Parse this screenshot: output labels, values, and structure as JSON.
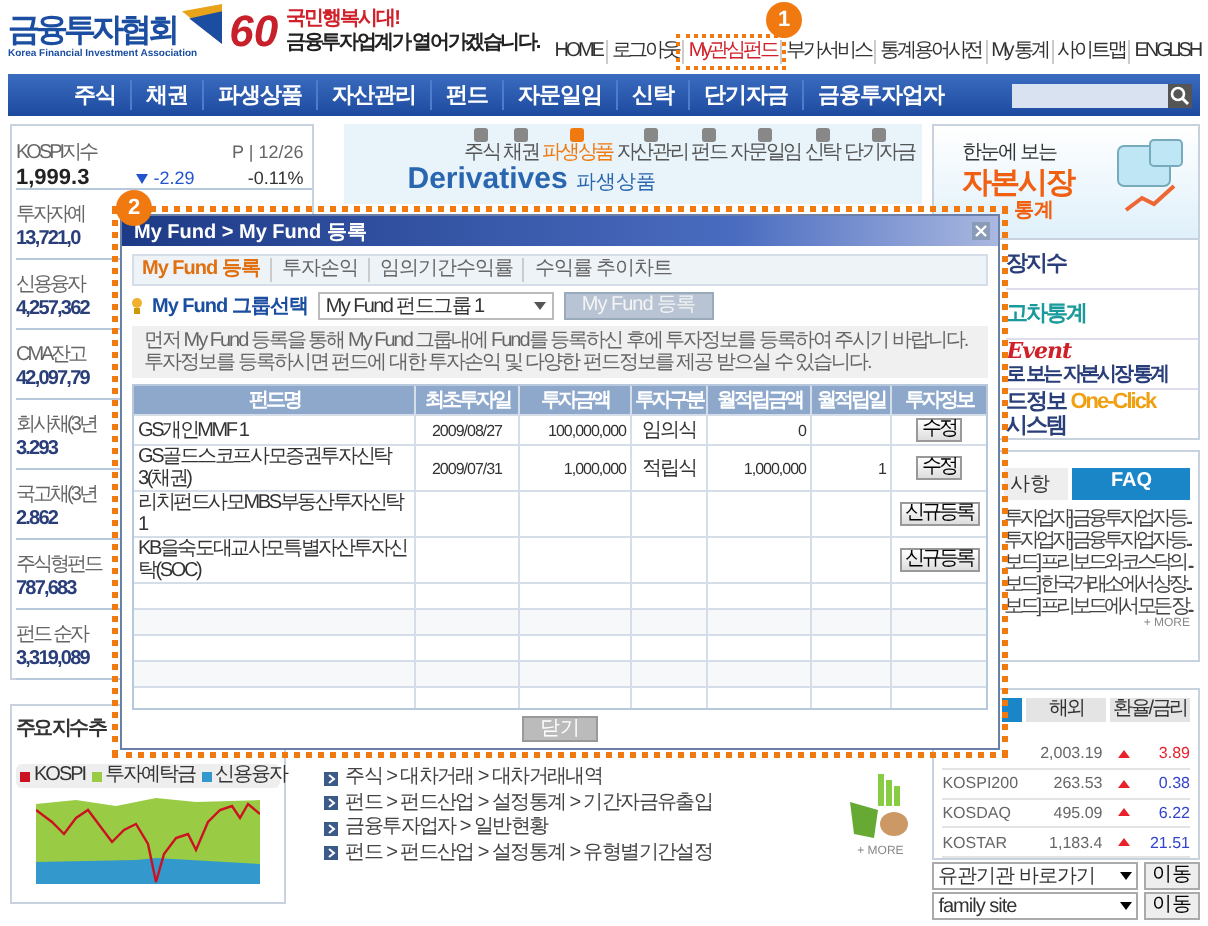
{
  "header": {
    "logo_text": "금융투자협회",
    "logo_subtitle": "Korea Financial Investment Association",
    "anniversary_number": "60",
    "slogan_line_1": "국민행복시대!",
    "slogan_line_2": "금융투자업계가 열어가겠습니다.",
    "top_links": [
      {
        "label": "HOME",
        "highlighted": false
      },
      {
        "label": "로그아웃",
        "highlighted": false
      },
      {
        "label": "My관심펀드",
        "highlighted": true
      },
      {
        "label": "부가서비스",
        "highlighted": false
      },
      {
        "label": "통계용어사전",
        "highlighted": false
      },
      {
        "label": "My 통계",
        "highlighted": false
      },
      {
        "label": "사이트맵",
        "highlighted": false
      },
      {
        "label": "ENGLISH",
        "highlighted": false
      }
    ],
    "callout": "1"
  },
  "nav": {
    "items": [
      "주식",
      "채권",
      "파생상품",
      "자산관리",
      "펀드",
      "자문일임",
      "신탁",
      "단기자금",
      "금융투자업자"
    ]
  },
  "left_stats": {
    "kospi": {
      "label": "KOSPI지수",
      "meta": "P | 12/26",
      "value": "1,999.3",
      "rising": false,
      "change": "-2.29",
      "rate": "-0.11%"
    },
    "items": [
      {
        "label": "투자자예",
        "value": "13,721,0"
      },
      {
        "label": "신용융자",
        "value": "4,257,362"
      },
      {
        "label": "CMA잔고",
        "value": "42,097,79"
      },
      {
        "label": "회사채(3년",
        "value": "3.293"
      },
      {
        "label": "국고채(3년",
        "value": "2.862"
      },
      {
        "label": "주식형펀드",
        "value": "787,683"
      },
      {
        "label": "펀드 순자",
        "value": "3,319,089"
      }
    ]
  },
  "index_chart": {
    "title": "주요 지수 추",
    "legend": [
      {
        "label": "KOSPI",
        "color": "#cc1122"
      },
      {
        "label": "투자예탁금",
        "color": "#99cc44"
      },
      {
        "label": "신용융자",
        "color": "#3399cc"
      }
    ]
  },
  "banner": {
    "title": "Derivatives",
    "subtitle": "파생상품",
    "categories": [
      {
        "label": "주식",
        "selected": false
      },
      {
        "label": "채권",
        "selected": false
      },
      {
        "label": "파생상품",
        "selected": true
      },
      {
        "label": "자산관리",
        "selected": false
      },
      {
        "label": "펀드",
        "selected": false
      },
      {
        "label": "자문일임",
        "selected": false
      },
      {
        "label": "신탁",
        "selected": false
      },
      {
        "label": "단기자금",
        "selected": false
      }
    ]
  },
  "quick_links": {
    "items": [
      "주식 > 대차거래 > 대차거래내역",
      "펀드 > 펀드산업 > 설정통계 > 기간자금유출입",
      "금융투자업자 > 일반현황",
      "펀드 > 펀드산업 > 설정통계 > 유형별기간설정"
    ],
    "more": "+ MORE"
  },
  "right": {
    "banner": {
      "line_1": "한눈에 보는",
      "line_2": "자본시장",
      "line_3": "통계"
    },
    "services": [
      {
        "parts": [
          {
            "text": "장지수",
            "kind": "plain"
          }
        ]
      },
      {
        "parts": [
          {
            "text": "고차통계",
            "kind": "teal"
          }
        ]
      },
      {
        "parts": [
          {
            "text": "Event",
            "kind": "event"
          },
          {
            "text": "로 보는 자본시장 통계",
            "kind": "small"
          }
        ]
      },
      {
        "parts": [
          {
            "text": "드정보",
            "kind": "plain"
          },
          {
            "text": "One-Click",
            "kind": "accent"
          },
          {
            "text": "시스템",
            "kind": "plain"
          }
        ]
      }
    ],
    "notice_tabs": [
      {
        "label": "사항",
        "selected": false
      },
      {
        "label": "FAQ",
        "selected": true
      }
    ],
    "notices": [
      "투자업자] 금융투자업자 등...",
      "투자업자] 금융투자업자 등...",
      "보드] 프리보드와 코스닥의 ...",
      "보드] 한국거래소에서 상장...",
      "보드] 프리보드에서 모든 장..."
    ],
    "notice_more": "+ MORE",
    "market_tabs": [
      {
        "selected": true
      },
      {
        "label": "해외",
        "selected": false
      },
      {
        "label": "환율/금리",
        "selected": false
      }
    ],
    "market_rows": [
      {
        "value": "2,003.19",
        "rising": true,
        "change": "3.89",
        "color": "#e8212b"
      },
      {
        "name": "KOSPI200",
        "value": "263.53",
        "rising": true,
        "change": "0.38",
        "color": "#3344cc"
      },
      {
        "name": "KOSDAQ",
        "value": "495.09",
        "rising": true,
        "change": "6.22",
        "color": "#3344cc"
      },
      {
        "name": "KOSTAR",
        "value": "1,183.4",
        "rising": true,
        "change": "21.51",
        "color": "#3344cc"
      }
    ],
    "selects": [
      {
        "value": "유관기관 바로가기",
        "button": "이동"
      },
      {
        "value": "family site",
        "button": "이동"
      }
    ]
  },
  "modal": {
    "callout": "2",
    "title": "My Fund > My Fund 등록",
    "tabs": [
      {
        "label": "My Fund 등록",
        "selected": true
      },
      {
        "label": "투자손익",
        "selected": false
      },
      {
        "label": "임의기간수익률",
        "selected": false
      },
      {
        "label": "수익률 추이차트",
        "selected": false
      }
    ],
    "group_label": "My Fund 그룹선택",
    "group_select": "My Fund 펀드그룹 1",
    "register_button": {
      "label": "My Fund 등록",
      "disabled": true
    },
    "notice": [
      "먼저 My Fund 등록을 통해 My Fund 그룹내에 Fund를 등록하신 후에 투자정보를 등록하여 주시기 바랍니다.",
      "투자정보를 등록하시면 펀드에 대한 투자손익 및 다양한 펀드정보를 제공 받으실 수 있습니다."
    ],
    "columns": [
      "펀드명",
      "최초투자일",
      "투자금액",
      "투자구분",
      "월적립금액",
      "월적립일",
      "투자정보"
    ],
    "rows": [
      {
        "fund": "GS개인MMF 1",
        "first_date": "2009/08/27",
        "amount": "100,000,000",
        "type": "임의식",
        "monthly_amount": "0",
        "action": "수정"
      },
      {
        "fund": "GS골드스코프사모증권투자신탁 3(채권)",
        "first_date": "2009/07/31",
        "amount": "1,000,000",
        "type": "적립식",
        "monthly_amount": "1,000,000",
        "monthly_day": "1",
        "action": "수정"
      },
      {
        "fund": "리치펀드사모MBS부동산투자신탁 1",
        "action": "신규등록"
      },
      {
        "fund": "KB을숙도대교사모특별자산투자신탁(SOC)",
        "action": "신규등록"
      }
    ],
    "close_button": "닫기"
  }
}
